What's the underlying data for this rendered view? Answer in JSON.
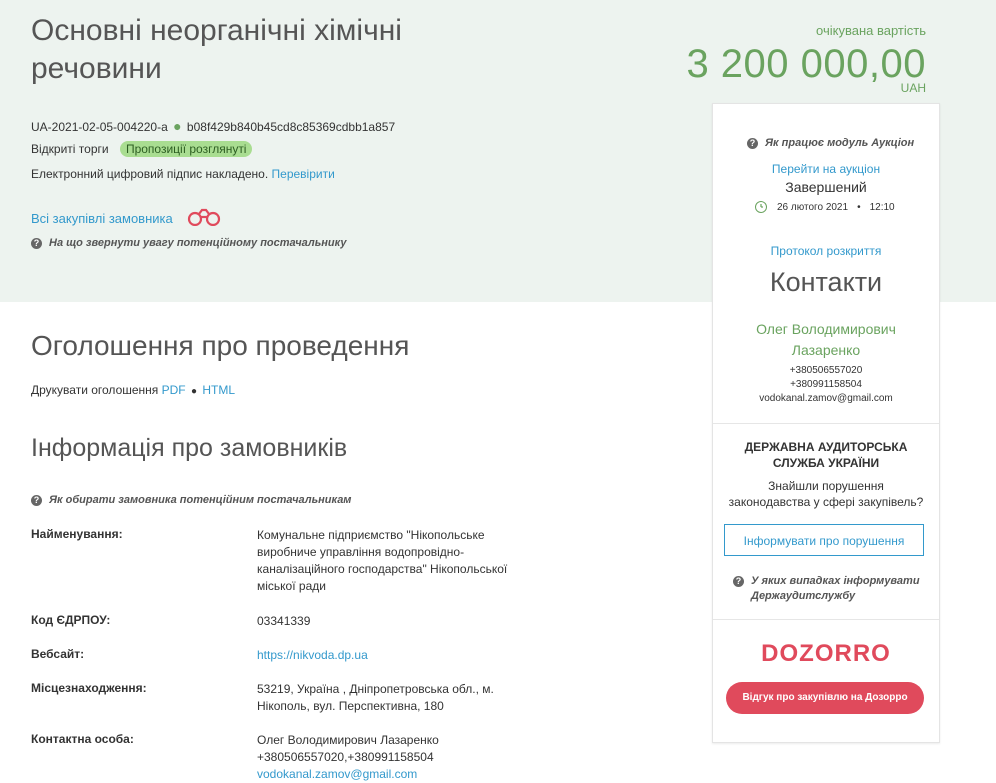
{
  "tender": {
    "title": "Основні неорганічні хімічні речовини",
    "price_label": "очікувана вартість",
    "price": "3 200 000,00",
    "currency": "UAH",
    "id": "UA-2021-02-05-004220-a",
    "hash": "b08f429b840b45cd8c85369cdbb1a857",
    "procedure": "Відкриті торги",
    "status_badge": "Пропозиції розглянуті",
    "signature_text": "Електронний цифровий підпис накладено.",
    "verify_link": "Перевірити",
    "all_purchases_link": "Всі закупівлі замовника",
    "hint_supplier": "На що звернути увагу потенційному постачальнику"
  },
  "announcement": {
    "heading": "Оголошення про проведення",
    "print_label": "Друкувати оголошення",
    "pdf_link": "PDF",
    "html_link": "HTML"
  },
  "customers": {
    "heading": "Інформація про замовників",
    "hint": "Як обирати замовника потенційним постачальникам",
    "rows": [
      {
        "label": "Найменування:",
        "value": "Комунальне підприємство \"Нікопольське виробниче управління водопровідно-каналізаційного господарства\" Нікопольської міської ради"
      },
      {
        "label": "Код ЄДРПОУ:",
        "value": "03341339"
      },
      {
        "label": "Вебсайт:",
        "value": "https://nikvoda.dp.ua"
      },
      {
        "label": "Місцезнаходження:",
        "value": "53219, Україна , Дніпропетровська обл., м. Нікополь, вул. Перспективна, 180"
      },
      {
        "label": "Контактна особа:",
        "value_name": "Олег Володимирович Лазаренко",
        "value_phones": "+380506557020,+380991158504",
        "value_email": "vodokanal.zamov@gmail.com"
      }
    ]
  },
  "sidebar": {
    "auction_hint": "Як працює модуль Аукціон",
    "auction_link": "Перейти на аукціон",
    "auction_status": "Завершений",
    "auction_date": "26 лютого 2021",
    "auction_time": "12:10",
    "protocol_link": "Протокол розкриття",
    "contacts_title": "Контакти",
    "contact_name": "Олег Володимирович Лазаренко",
    "contact_phone1": "+380506557020",
    "contact_phone2": "+380991158504",
    "contact_email": "vodokanal.zamov@gmail.com",
    "audit_title": "ДЕРЖАВНА АУДИТОРСЬКА СЛУЖБА УКРАЇНИ",
    "audit_text": "Знайшли порушення законодавства у сфері закупівель?",
    "report_button": "Інформувати про порушення",
    "report_hint": "У яких випадках інформувати Держаудитслужбу",
    "dozorro_logo": "DOZORRO",
    "dozorro_button": "Відгук про закупівлю на Дозорро"
  },
  "colors": {
    "accent_green": "#6aa35f",
    "link_blue": "#3399cc",
    "band_bg": "#edf3ef",
    "dozorro_red": "#e04a5c"
  }
}
